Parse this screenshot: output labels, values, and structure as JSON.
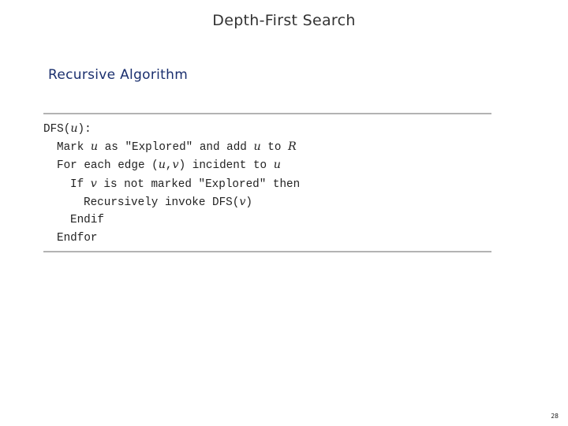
{
  "slide": {
    "title": "Depth-First Search",
    "subtitle": "Recursive Algorithm",
    "page_number": "28"
  },
  "algorithm": {
    "lines": [
      {
        "indent": 0,
        "parts": [
          {
            "t": "DFS("
          },
          {
            "t": "u",
            "var": true
          },
          {
            "t": "):"
          }
        ]
      },
      {
        "indent": 1,
        "parts": [
          {
            "t": "Mark "
          },
          {
            "t": "u",
            "var": true
          },
          {
            "t": " as \"Explored\" and add "
          },
          {
            "t": "u",
            "var": true
          },
          {
            "t": " to "
          },
          {
            "t": "R",
            "var": true
          }
        ]
      },
      {
        "indent": 1,
        "parts": [
          {
            "t": "For each edge ("
          },
          {
            "t": "u",
            "var": true
          },
          {
            "t": ","
          },
          {
            "t": "v",
            "var": true
          },
          {
            "t": ") incident to "
          },
          {
            "t": "u",
            "var": true
          }
        ]
      },
      {
        "indent": 2,
        "parts": [
          {
            "t": "If "
          },
          {
            "t": "v",
            "var": true
          },
          {
            "t": " is not marked \"Explored\" then"
          }
        ]
      },
      {
        "indent": 3,
        "parts": [
          {
            "t": "Recursively invoke DFS("
          },
          {
            "t": "v",
            "var": true
          },
          {
            "t": ")"
          }
        ]
      },
      {
        "indent": 2,
        "parts": [
          {
            "t": "Endif"
          }
        ]
      },
      {
        "indent": 1,
        "parts": [
          {
            "t": "Endfor"
          }
        ]
      }
    ]
  }
}
